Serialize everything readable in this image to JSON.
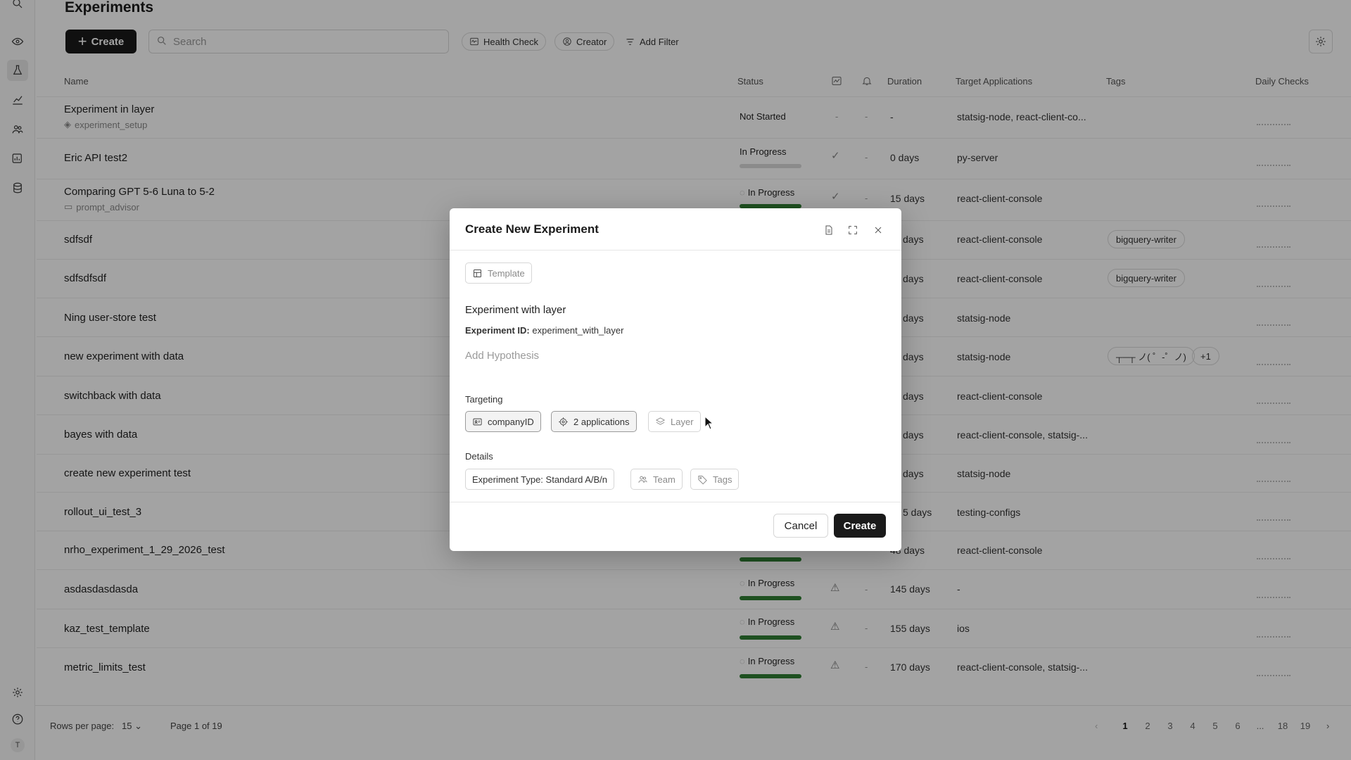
{
  "header": {
    "title": "Experiments",
    "create_label": "Create",
    "search_placeholder": "Search",
    "filters": [
      "Health Check",
      "Creator"
    ],
    "add_filter_label": "Add Filter"
  },
  "table": {
    "columns": {
      "name": "Name",
      "status": "Status",
      "duration": "Duration",
      "targets": "Target Applications",
      "tags": "Tags",
      "daily": "Daily Checks"
    },
    "rows": [
      {
        "name": "Experiment in layer",
        "sub": "experiment_setup",
        "status": "Not Started",
        "duration": "-",
        "targets": "statsig-node, react-client-co..."
      },
      {
        "name": "Eric API test2",
        "status": "In Progress",
        "duration": "0 days",
        "targets": "py-server"
      },
      {
        "name": "Comparing GPT 5-6 Luna to 5-2",
        "sub": "prompt_advisor",
        "status": "In Progress",
        "duration": "15 days",
        "targets": "react-client-console"
      },
      {
        "name": "sdfsdf",
        "duration": "days",
        "targets": "react-client-console",
        "tag": "bigquery-writer"
      },
      {
        "name": "sdfsdfsdf",
        "duration": "days",
        "targets": "react-client-console",
        "tag": "bigquery-writer"
      },
      {
        "name": "Ning user-store test",
        "duration": "days",
        "targets": "statsig-node"
      },
      {
        "name": "new experiment with data",
        "duration": "days",
        "targets": "statsig-node",
        "tag": "┬─┬ ノ( ゜-゜ノ)",
        "tag_more": "+1"
      },
      {
        "name": "switchback with data",
        "duration": "days",
        "targets": "react-client-console"
      },
      {
        "name": "bayes with data",
        "duration": "days",
        "targets": "react-client-console, statsig-..."
      },
      {
        "name": "create new experiment test",
        "duration": "days",
        "targets": "statsig-node"
      },
      {
        "name": "rollout_ui_test_3",
        "duration": "5 days",
        "targets": "testing-configs"
      },
      {
        "name": "nrho_experiment_1_29_2026_test",
        "duration": "48 days",
        "targets": "react-client-console"
      },
      {
        "name": "asdasdasdasda",
        "status": "In Progress",
        "duration": "145 days",
        "targets": "-"
      },
      {
        "name": "kaz_test_template",
        "status": "In Progress",
        "duration": "155 days",
        "targets": "ios"
      },
      {
        "name": "metric_limits_test",
        "status": "In Progress",
        "duration": "170 days",
        "targets": "react-client-console, statsig-..."
      }
    ],
    "dash": "-"
  },
  "footer": {
    "rows_label": "Rows per page:",
    "rows_value": "15",
    "page_label": "Page 1 of 19",
    "pages": [
      "1",
      "2",
      "3",
      "4",
      "5",
      "6",
      "...",
      "18",
      "19"
    ]
  },
  "modal": {
    "title": "Create New Experiment",
    "template_label": "Template",
    "experiment_name": "Experiment with layer",
    "id_label": "Experiment ID:",
    "id_value": "experiment_with_layer",
    "hypothesis_placeholder": "Add Hypothesis",
    "targeting_label": "Targeting",
    "unit": "companyID",
    "applications": "2 applications",
    "layer": "Layer",
    "details_label": "Details",
    "experiment_type": "Experiment Type: Standard A/B/n",
    "team": "Team",
    "tags": "Tags",
    "cancel": "Cancel",
    "create": "Create"
  },
  "user_initial": "T",
  "colors": {
    "progress": "#2f7d32",
    "primary": "#1a1a1a"
  }
}
